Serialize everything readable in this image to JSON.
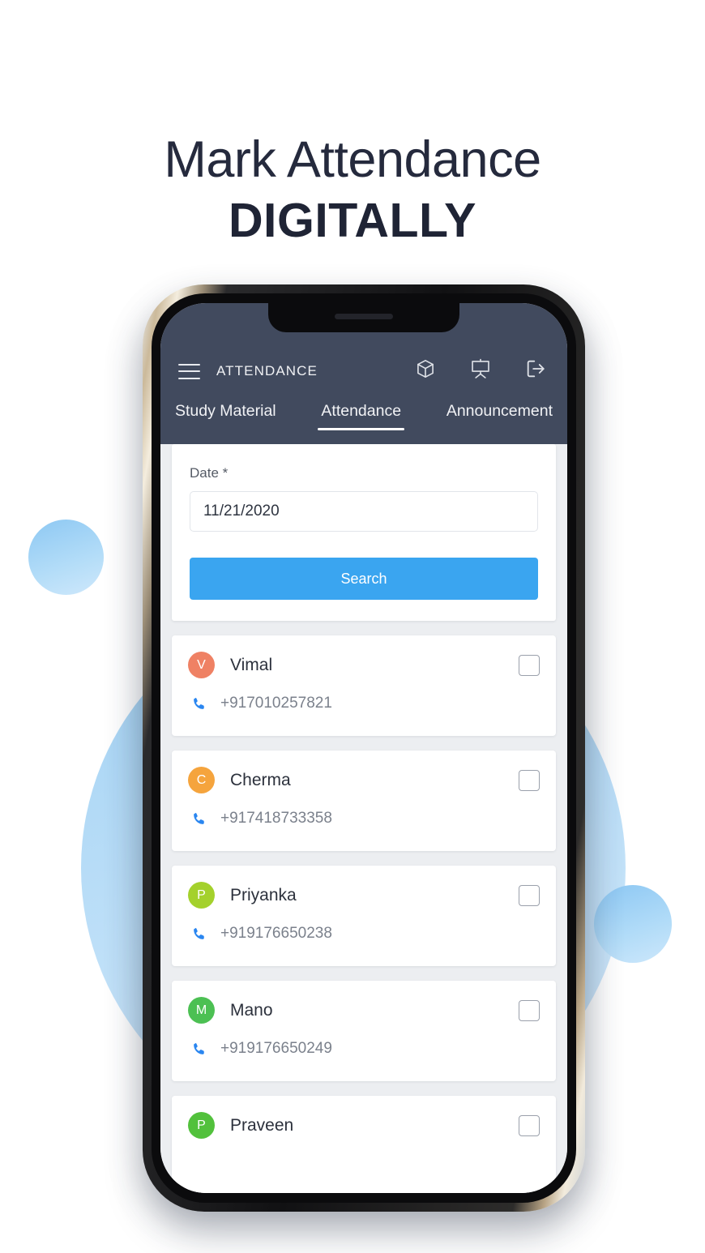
{
  "headline": {
    "line1": "Mark Attendance",
    "line2": "DIGITALLY"
  },
  "appbar": {
    "title": "ATTENDANCE",
    "menu_icon": "hamburger-menu-icon",
    "actions": [
      {
        "name": "cube-icon",
        "label": "3D Cube"
      },
      {
        "name": "presentation-board-icon",
        "label": "Presentation"
      },
      {
        "name": "logout-icon",
        "label": "Logout"
      }
    ]
  },
  "tabs": [
    {
      "label": "Study Material",
      "active": false
    },
    {
      "label": "Attendance",
      "active": true
    },
    {
      "label": "Announcement",
      "active": false
    }
  ],
  "search": {
    "date_label": "Date *",
    "date_value": "11/21/2020",
    "date_placeholder": "MM/DD/YYYY",
    "button_label": "Search"
  },
  "students": [
    {
      "initial": "V",
      "name": "Vimal",
      "phone": "+917010257821",
      "avatar_color": "#ef8164",
      "checked": false
    },
    {
      "initial": "C",
      "name": "Cherma",
      "phone": "+917418733358",
      "avatar_color": "#f5a43d",
      "checked": false
    },
    {
      "initial": "P",
      "name": "Priyanka",
      "phone": "+919176650238",
      "avatar_color": "#a4d12c",
      "checked": false
    },
    {
      "initial": "M",
      "name": "Mano",
      "phone": "+919176650249",
      "avatar_color": "#4cc053",
      "checked": false
    },
    {
      "initial": "P",
      "name": "Praveen",
      "phone": "",
      "avatar_color": "#52c13c",
      "checked": false
    }
  ],
  "colors": {
    "appbar_bg": "#414a5e",
    "accent_blue": "#3aa5f0",
    "phone_icon_blue": "#2a86f0",
    "screen_bg": "#eceef1",
    "headline_text": "#252a3d",
    "deco_circle": "#a2d2f4"
  }
}
